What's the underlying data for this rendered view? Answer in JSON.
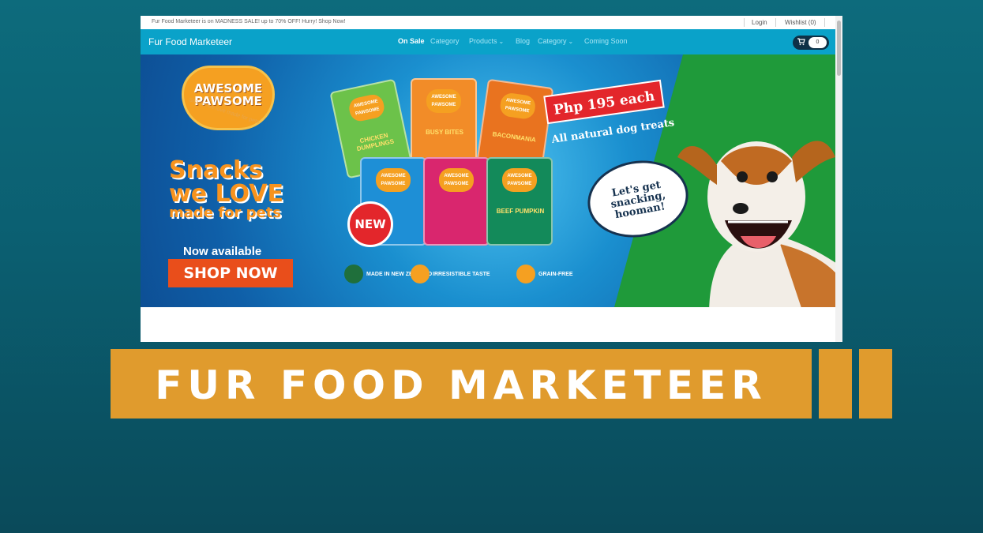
{
  "topbar": {
    "promo": "Fur Food Marketeer is on MADNESS SALE! up to 70% OFF! Hurry! Shop Now!",
    "login": "Login",
    "wishlist": "Wishlist (0)"
  },
  "navbar": {
    "brand": "Fur Food Marketeer",
    "items": [
      {
        "label": "On Sale",
        "active": true,
        "dropdown": false
      },
      {
        "label": "Category",
        "active": false,
        "dropdown": false
      },
      {
        "label": "Products",
        "active": false,
        "dropdown": true
      },
      {
        "label": "Blog",
        "active": false,
        "dropdown": false
      },
      {
        "label": "Category",
        "active": false,
        "dropdown": true
      },
      {
        "label": "Coming Soon",
        "active": false,
        "dropdown": false
      }
    ],
    "cart_icon": "shopping-cart-icon",
    "cart_count": "0"
  },
  "hero": {
    "logo_line1": "AWESOME",
    "logo_line2": "PAWSOME",
    "logo_sub": "Snacks we love made for pets",
    "tagline_1": "Snacks",
    "tagline_2": "we LOVE",
    "tagline_3": "made for pets",
    "now_available": "Now available",
    "shop_now": "SHOP NOW",
    "price": "Php 195 each",
    "natural": "All natural dog treats",
    "bubble_1": "Let's get",
    "bubble_2": "snacking,",
    "bubble_3": "hooman!",
    "new_badge": "NEW",
    "packs": [
      {
        "name": "CHICKEN DUMPLINGS",
        "color": "#6cc24a"
      },
      {
        "name": "BUSY BITES",
        "color": "#f28c28"
      },
      {
        "name": "BACONMANIA",
        "color": "#e9731f"
      },
      {
        "name": "",
        "color": "#1e8fd6"
      },
      {
        "name": "",
        "color": "#d9266e"
      },
      {
        "name": "BEEF PUMPKIN",
        "color": "#138a5a"
      }
    ],
    "features": [
      {
        "label": "MADE IN NEW ZEALAND",
        "icon": "fern-icon"
      },
      {
        "label": "IRRESISTIBLE TASTE",
        "icon": "taste-icon"
      },
      {
        "label": "GRAIN-FREE",
        "icon": "grain-free-icon"
      }
    ]
  },
  "banner": {
    "title": "FUR FOOD MARKETEER"
  },
  "colors": {
    "background": "#0d6b7c",
    "navbar": "#0aa2c9",
    "accent": "#e09b2d",
    "shop_now": "#e94e1b",
    "price_tag": "#e3262b"
  }
}
